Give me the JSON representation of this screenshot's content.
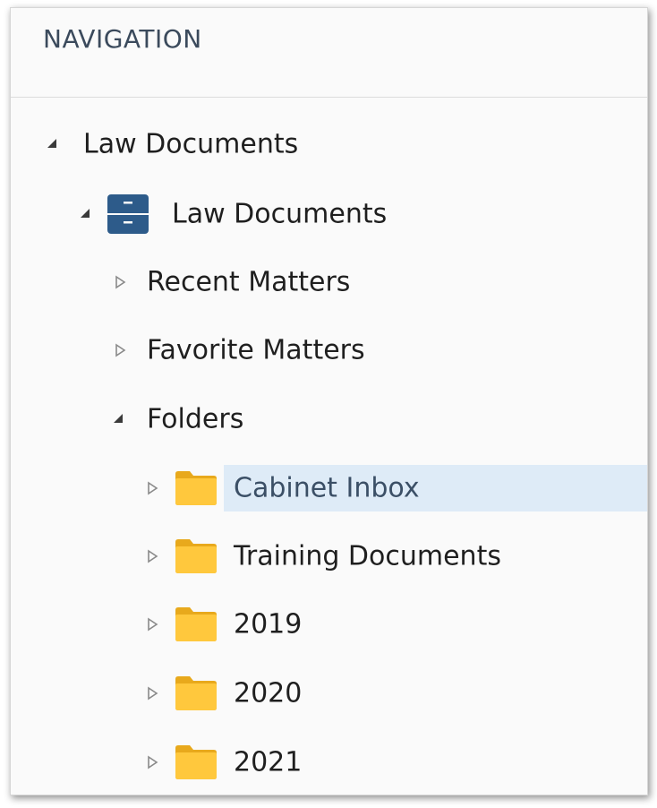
{
  "header": {
    "title": "NAVIGATION"
  },
  "tree": {
    "root": {
      "label": "Law Documents",
      "expanded": true,
      "icon": "expanded-caret-icon"
    },
    "cabinet": {
      "label": "Law Documents",
      "expanded": true,
      "icon": "file-cabinet-icon",
      "icon_color": "#2d5b8a"
    },
    "recent": {
      "label": "Recent Matters",
      "expanded": false
    },
    "favorite": {
      "label": "Favorite Matters",
      "expanded": false
    },
    "folders": {
      "label": "Folders",
      "expanded": true
    },
    "folder_items": [
      {
        "label": "Cabinet Inbox",
        "selected": true,
        "icon": "folder-icon"
      },
      {
        "label": "Training Documents",
        "selected": false,
        "icon": "folder-icon"
      },
      {
        "label": "2019",
        "selected": false,
        "icon": "folder-icon"
      },
      {
        "label": "2020",
        "selected": false,
        "icon": "folder-icon"
      },
      {
        "label": "2021",
        "selected": false,
        "icon": "folder-icon"
      }
    ]
  },
  "colors": {
    "folder": "#ffc83d",
    "folder_shadow": "#e8a91c",
    "selection": "#deebf7",
    "cabinet": "#2d5b8a"
  }
}
